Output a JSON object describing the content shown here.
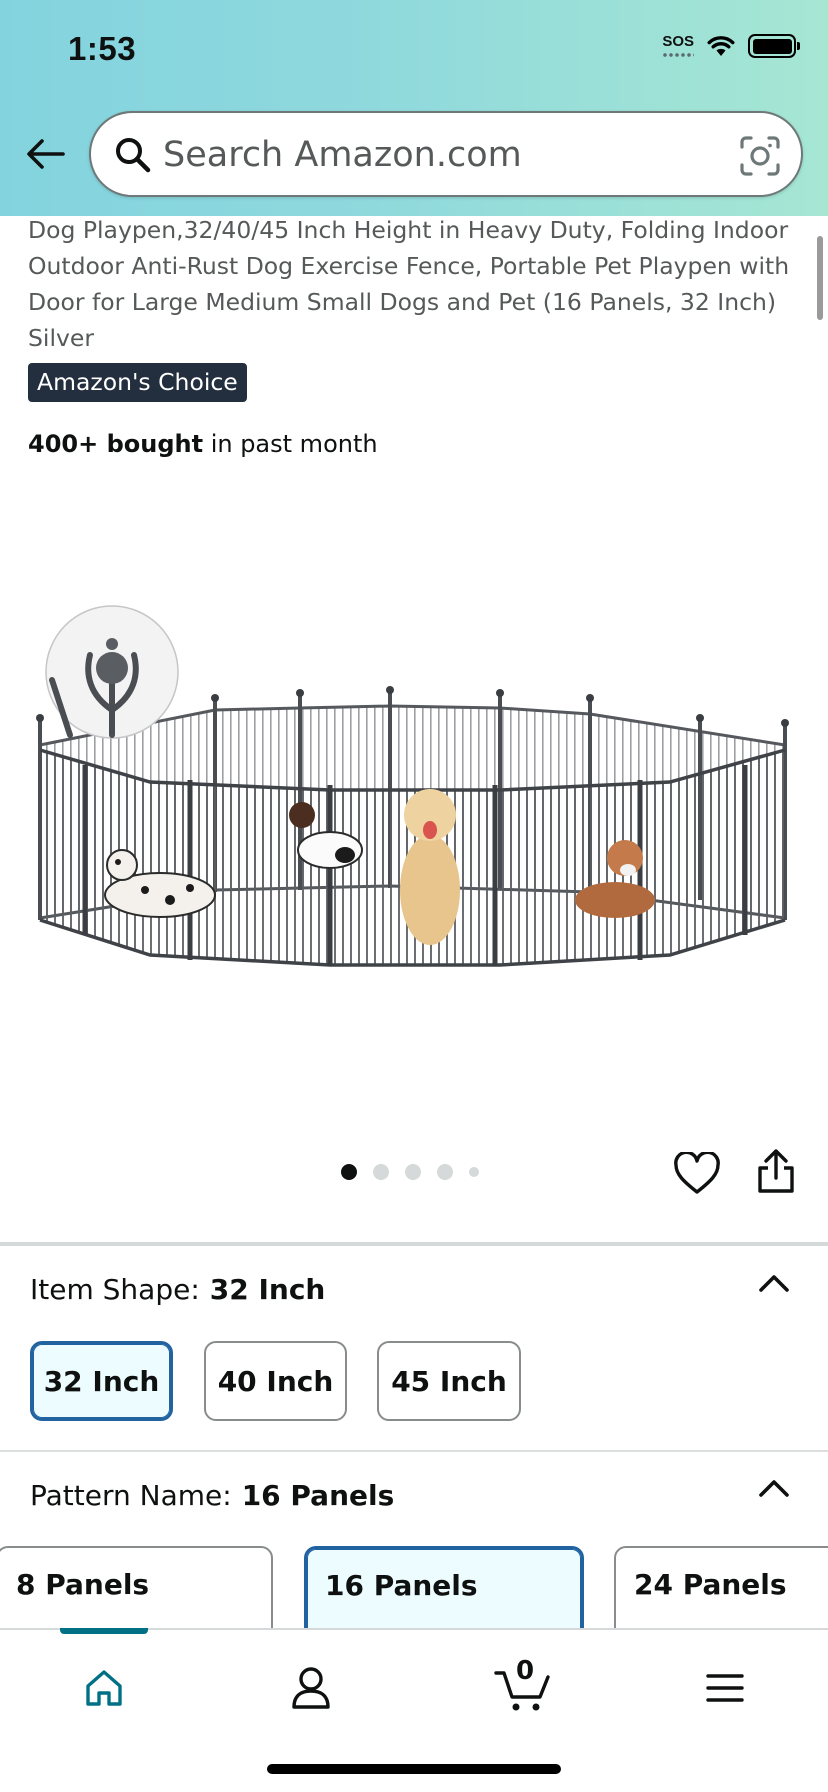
{
  "status_bar": {
    "time": "1:53",
    "sos": "SOS"
  },
  "search": {
    "placeholder": "Search Amazon.com"
  },
  "product": {
    "title": "Dog Playpen,32/40/45 Inch Height in Heavy Duty, Folding Indoor Outdoor Anti-Rust Dog Exercise Fence, Portable Pet Playpen with Door for Large Medium Small Dogs and Pet (16 Panels, 32 Inch) Silver",
    "badge": "Amazon's Choice",
    "bought_bold": "400+ bought",
    "bought_rest": " in past month",
    "image_count": 5,
    "active_image_index": 0
  },
  "item_shape": {
    "label": "Item Shape:",
    "selected": "32 Inch",
    "options": [
      "32 Inch",
      "40 Inch",
      "45 Inch"
    ]
  },
  "pattern_name": {
    "label": "Pattern Name:",
    "selected": "16 Panels",
    "options": [
      "8 Panels",
      "16 Panels",
      "24 Panels"
    ]
  },
  "bottom_nav": {
    "items": [
      "home-icon",
      "account-icon",
      "cart-icon",
      "menu-icon"
    ],
    "cart_count": "0",
    "accent": "#007185"
  },
  "colors": {
    "selected_border": "#2162a1",
    "badge_bg": "#232f3e",
    "header_start": "#83d3de",
    "header_end": "#a6e6d3"
  }
}
